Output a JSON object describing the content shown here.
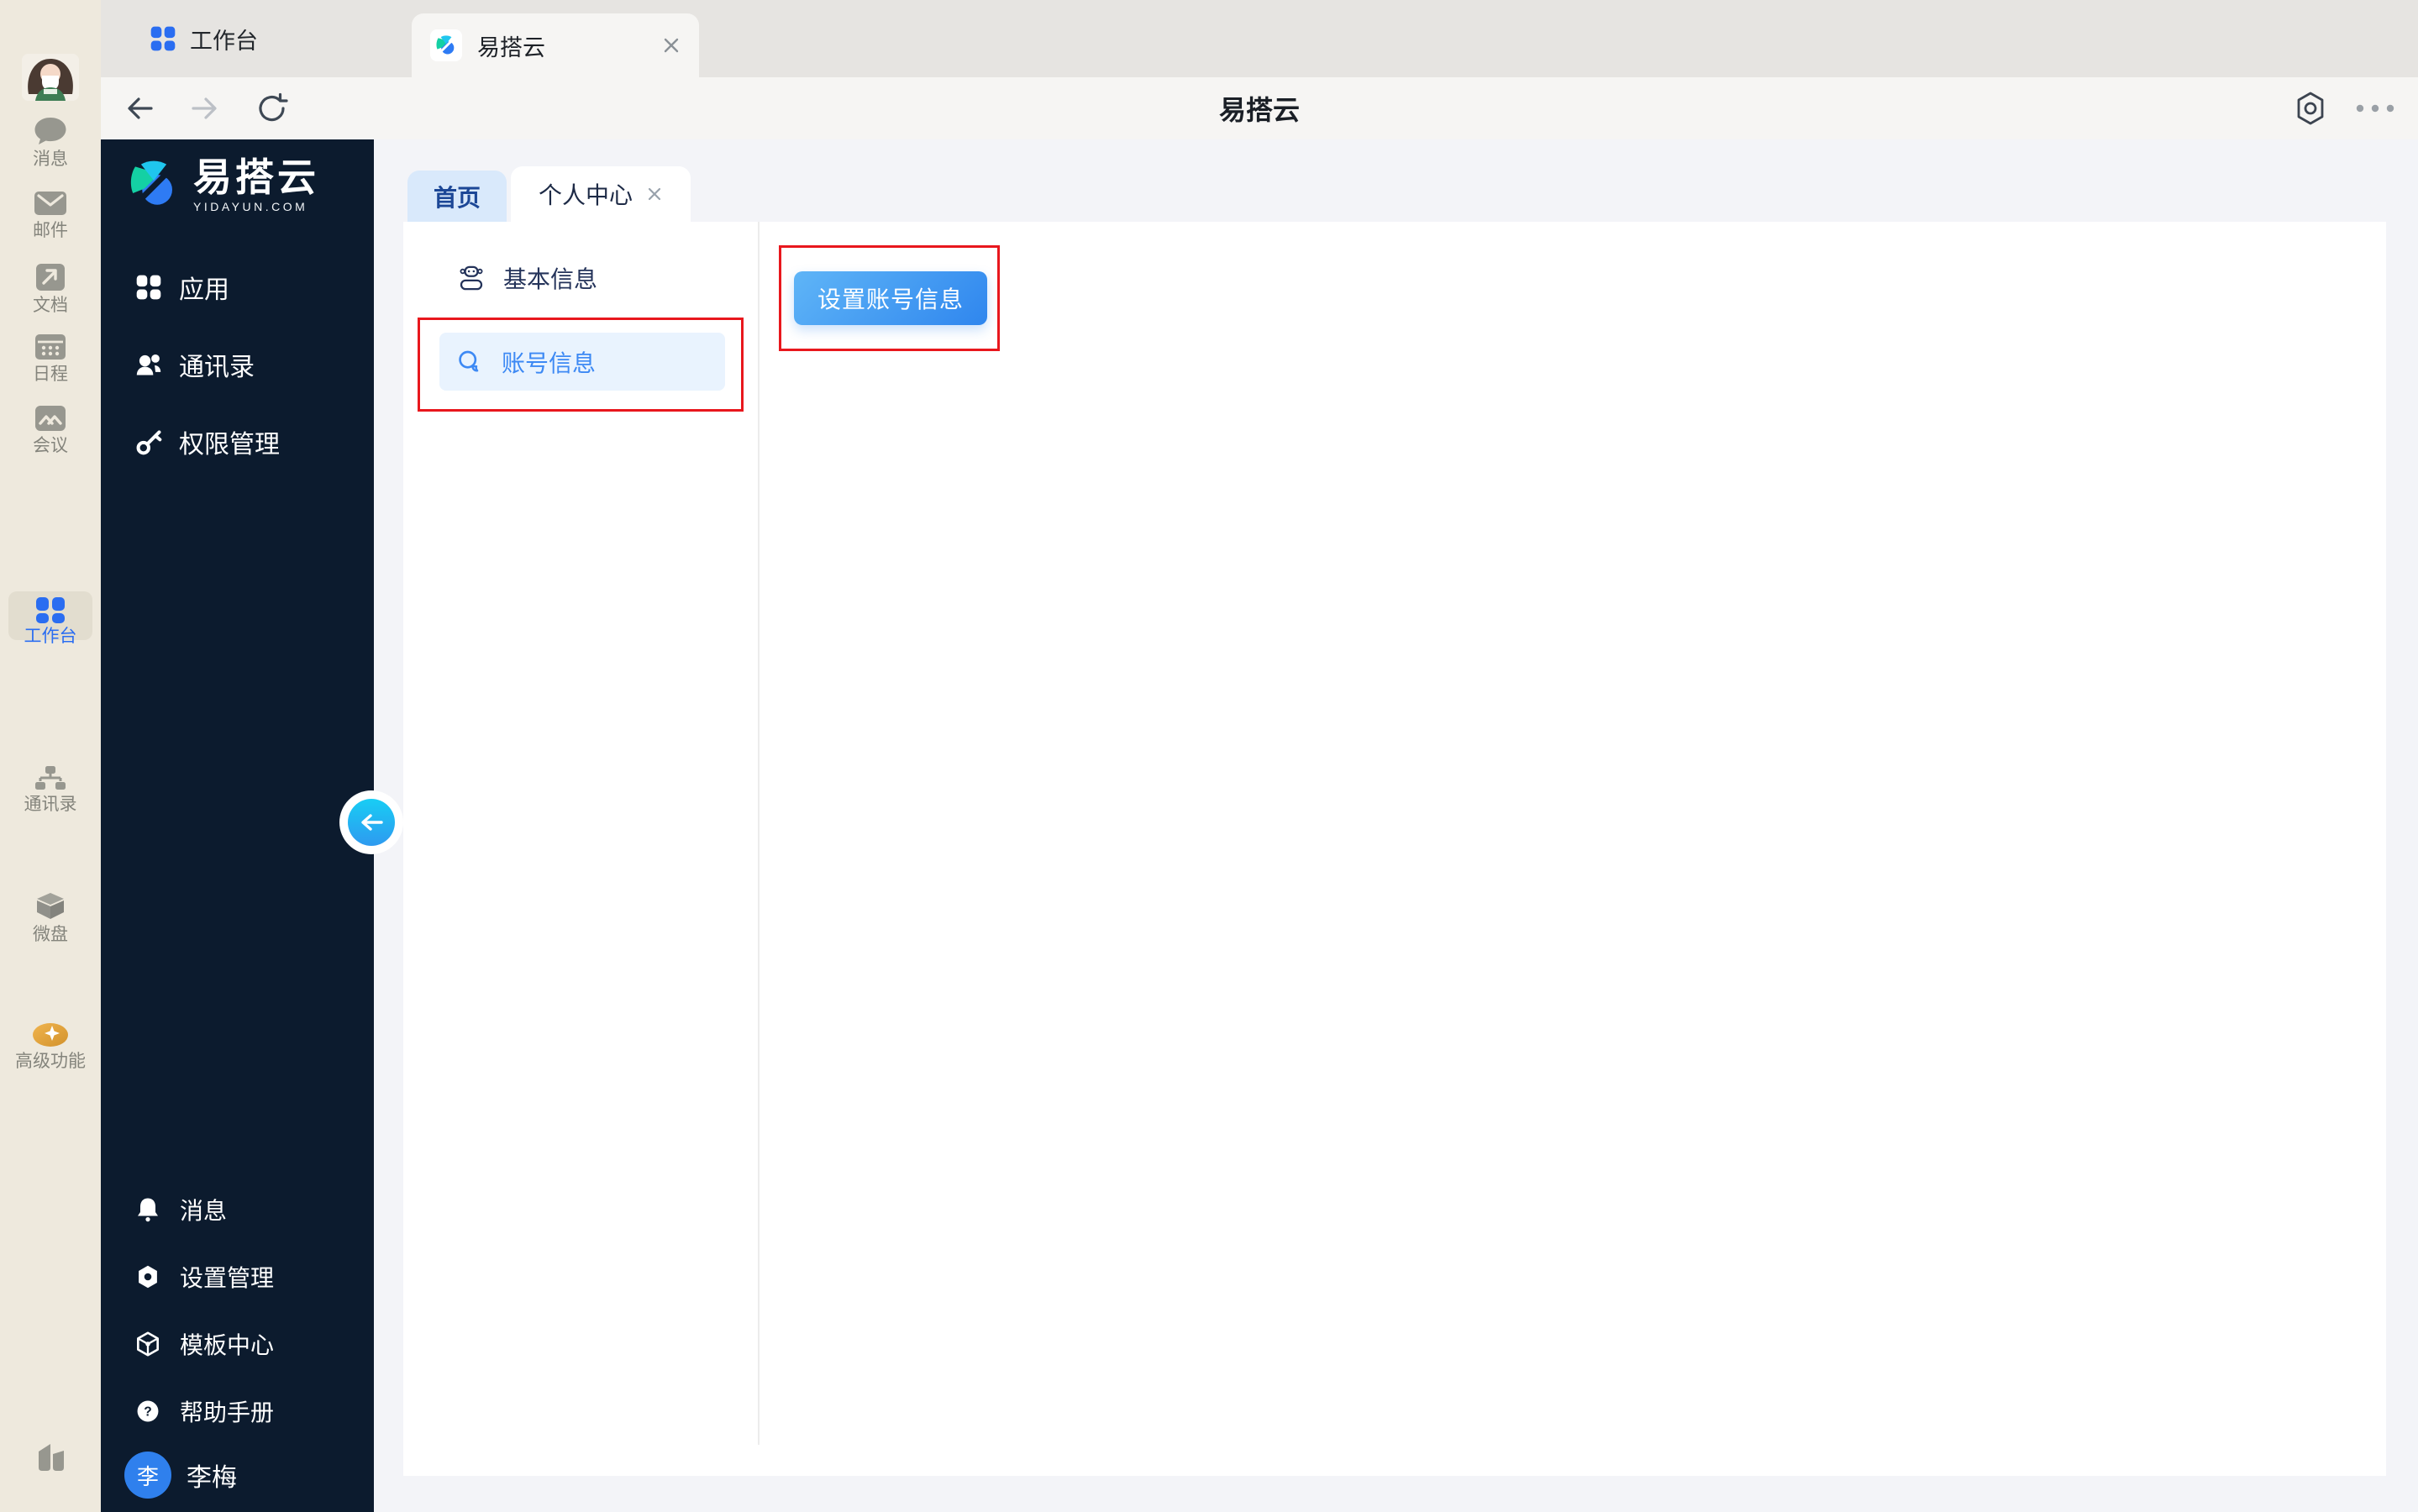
{
  "os_sidebar": {
    "items_top": [
      {
        "label": "消息"
      },
      {
        "label": "邮件"
      },
      {
        "label": "文档"
      },
      {
        "label": "日程"
      },
      {
        "label": "会议"
      }
    ],
    "items_mid": [
      {
        "label": "工作台",
        "active": true
      },
      {
        "label": "通讯录"
      },
      {
        "label": "微盘"
      },
      {
        "label": "高级功能"
      }
    ]
  },
  "window": {
    "tabs": [
      {
        "label": "工作台"
      },
      {
        "label": "易搭云",
        "active": true,
        "closable": true
      }
    ],
    "toolbar_title": "易搭云"
  },
  "app_sidebar": {
    "logo_title": "易搭云",
    "logo_domain": "YIDAYUN.COM",
    "menu": [
      {
        "label": "应用"
      },
      {
        "label": "通讯录"
      },
      {
        "label": "权限管理"
      }
    ],
    "footer_menu": [
      {
        "label": "消息"
      },
      {
        "label": "设置管理"
      },
      {
        "label": "模板中心"
      },
      {
        "label": "帮助手册"
      }
    ],
    "user": {
      "name": "李梅",
      "initial": "李"
    }
  },
  "content": {
    "tabs": [
      {
        "label": "首页"
      },
      {
        "label": "个人中心",
        "active": true,
        "closable": true
      }
    ],
    "side_nav": [
      {
        "label": "基本信息"
      },
      {
        "label": "账号信息",
        "active": true
      }
    ],
    "action_button": "设置账号信息"
  },
  "colors": {
    "accent_blue": "#2a6df1",
    "content_blue": "#3d89f4",
    "annotation_red": "#e8171d",
    "sidebar_dark": "#0c1b2e",
    "os_sidebar_beige": "#eee9dd"
  }
}
